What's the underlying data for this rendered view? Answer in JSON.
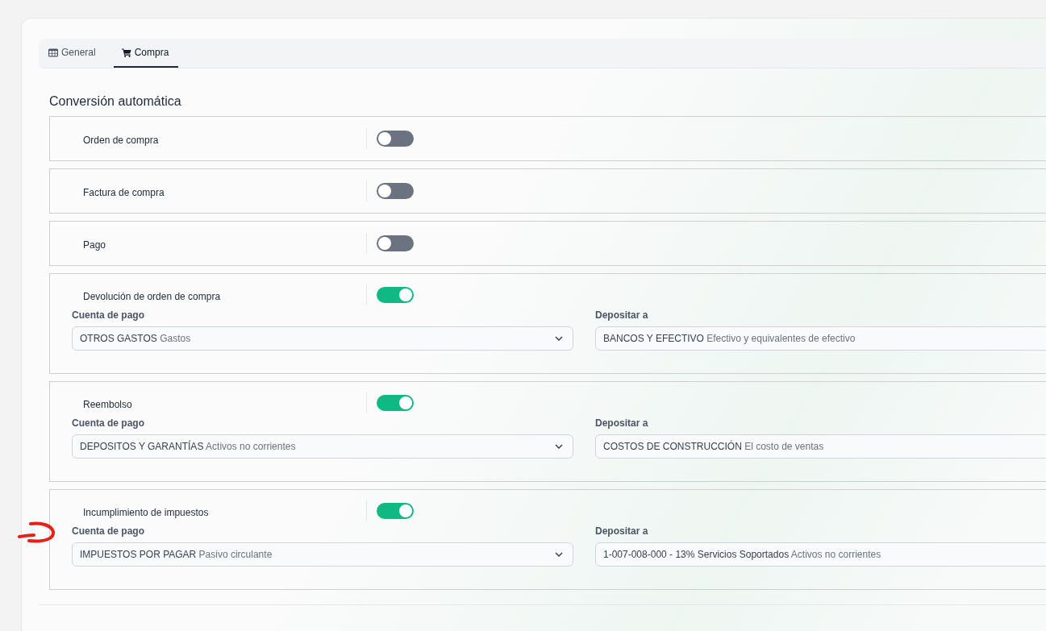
{
  "tabs": [
    {
      "label": "General",
      "selected": false
    },
    {
      "label": "Compra",
      "selected": true
    }
  ],
  "section_title": "Conversión automática",
  "rows": [
    {
      "label": "Orden de compra",
      "on": false
    },
    {
      "label": "Factura de compra",
      "on": false
    },
    {
      "label": "Pago",
      "on": false
    },
    {
      "label": "Devolución de orden de compra",
      "on": true,
      "fields": [
        {
          "label": "Cuenta de pago",
          "value": "OTROS GASTOS",
          "detail": "Gastos"
        },
        {
          "label": "Depositar a",
          "value": "BANCOS Y EFECTIVO",
          "detail": "Efectivo y equivalentes de efectivo"
        }
      ]
    },
    {
      "label": "Reembolso",
      "on": true,
      "fields": [
        {
          "label": "Cuenta de pago",
          "value": "DEPOSITOS Y GARANTÍAS",
          "detail": "Activos no corrientes"
        },
        {
          "label": "Depositar a",
          "value": "COSTOS DE CONSTRUCCIÓN",
          "detail": "El costo de ventas"
        }
      ]
    },
    {
      "label": "Incumplimiento de impuestos",
      "on": true,
      "fields": [
        {
          "label": "Cuenta de pago",
          "value": "IMPUESTOS POR PAGAR",
          "detail": "Pasivo circulante"
        },
        {
          "label": "Depositar a",
          "value": "1-007-008-000 - 13% Servicios Soportados",
          "detail": "Activos no corrientes"
        }
      ]
    }
  ]
}
